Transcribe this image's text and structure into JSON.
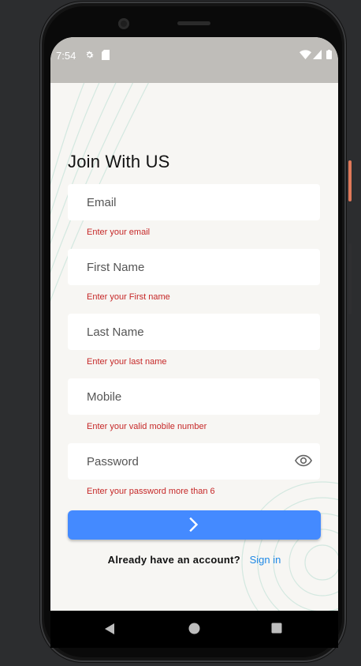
{
  "status_bar": {
    "time": "7:54",
    "left_icons": [
      "gear-icon",
      "sd-card-icon"
    ],
    "right_icons": [
      "wifi-icon",
      "cellular-signal-icon",
      "battery-icon"
    ],
    "background": "#bfbdb9"
  },
  "form": {
    "title": "Join With US",
    "fields": [
      {
        "placeholder": "Email",
        "value": "",
        "error": "Enter your email"
      },
      {
        "placeholder": "First Name",
        "value": "",
        "error": "Enter your First name"
      },
      {
        "placeholder": "Last Name",
        "value": "",
        "error": "Enter your last name"
      },
      {
        "placeholder": "Mobile",
        "value": "",
        "error": "Enter your valid mobile number"
      },
      {
        "placeholder": "Password",
        "value": "",
        "error": "Enter your password more than 6",
        "trailing_icon": "eye-icon"
      }
    ],
    "submit_icon": "chevron-right-icon",
    "signin_prompt": "Already have an account?",
    "signin_link": "Sign in"
  },
  "nav_bar": {
    "buttons": [
      "back-triangle-icon",
      "home-circle-icon",
      "recents-square-icon"
    ]
  },
  "colors": {
    "accent": "#448aff",
    "error": "#c62828",
    "link": "#1e88e5",
    "background": "#f7f6f3",
    "decoration": "#d3e8e0"
  }
}
